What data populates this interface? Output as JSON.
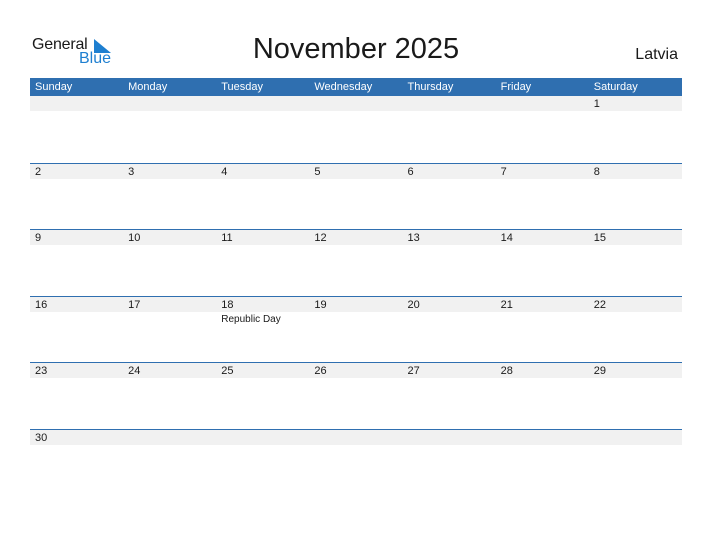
{
  "logo": {
    "general": "General",
    "blue": "Blue"
  },
  "title": "November 2025",
  "country": "Latvia",
  "colors": {
    "header_bg": "#2f6fb0",
    "band_bg": "#f1f1f1",
    "logo_blue": "#1e7fd0"
  },
  "weekdays": [
    "Sunday",
    "Monday",
    "Tuesday",
    "Wednesday",
    "Thursday",
    "Friday",
    "Saturday"
  ],
  "weeks": [
    [
      {
        "d": ""
      },
      {
        "d": ""
      },
      {
        "d": ""
      },
      {
        "d": ""
      },
      {
        "d": ""
      },
      {
        "d": ""
      },
      {
        "d": "1"
      }
    ],
    [
      {
        "d": "2"
      },
      {
        "d": "3"
      },
      {
        "d": "4"
      },
      {
        "d": "5"
      },
      {
        "d": "6"
      },
      {
        "d": "7"
      },
      {
        "d": "8"
      }
    ],
    [
      {
        "d": "9"
      },
      {
        "d": "10"
      },
      {
        "d": "11"
      },
      {
        "d": "12"
      },
      {
        "d": "13"
      },
      {
        "d": "14"
      },
      {
        "d": "15"
      }
    ],
    [
      {
        "d": "16"
      },
      {
        "d": "17"
      },
      {
        "d": "18",
        "h": "Republic Day"
      },
      {
        "d": "19"
      },
      {
        "d": "20"
      },
      {
        "d": "21"
      },
      {
        "d": "22"
      }
    ],
    [
      {
        "d": "23"
      },
      {
        "d": "24"
      },
      {
        "d": "25"
      },
      {
        "d": "26"
      },
      {
        "d": "27"
      },
      {
        "d": "28"
      },
      {
        "d": "29"
      }
    ],
    [
      {
        "d": "30"
      },
      {
        "d": ""
      },
      {
        "d": ""
      },
      {
        "d": ""
      },
      {
        "d": ""
      },
      {
        "d": ""
      },
      {
        "d": ""
      }
    ]
  ]
}
